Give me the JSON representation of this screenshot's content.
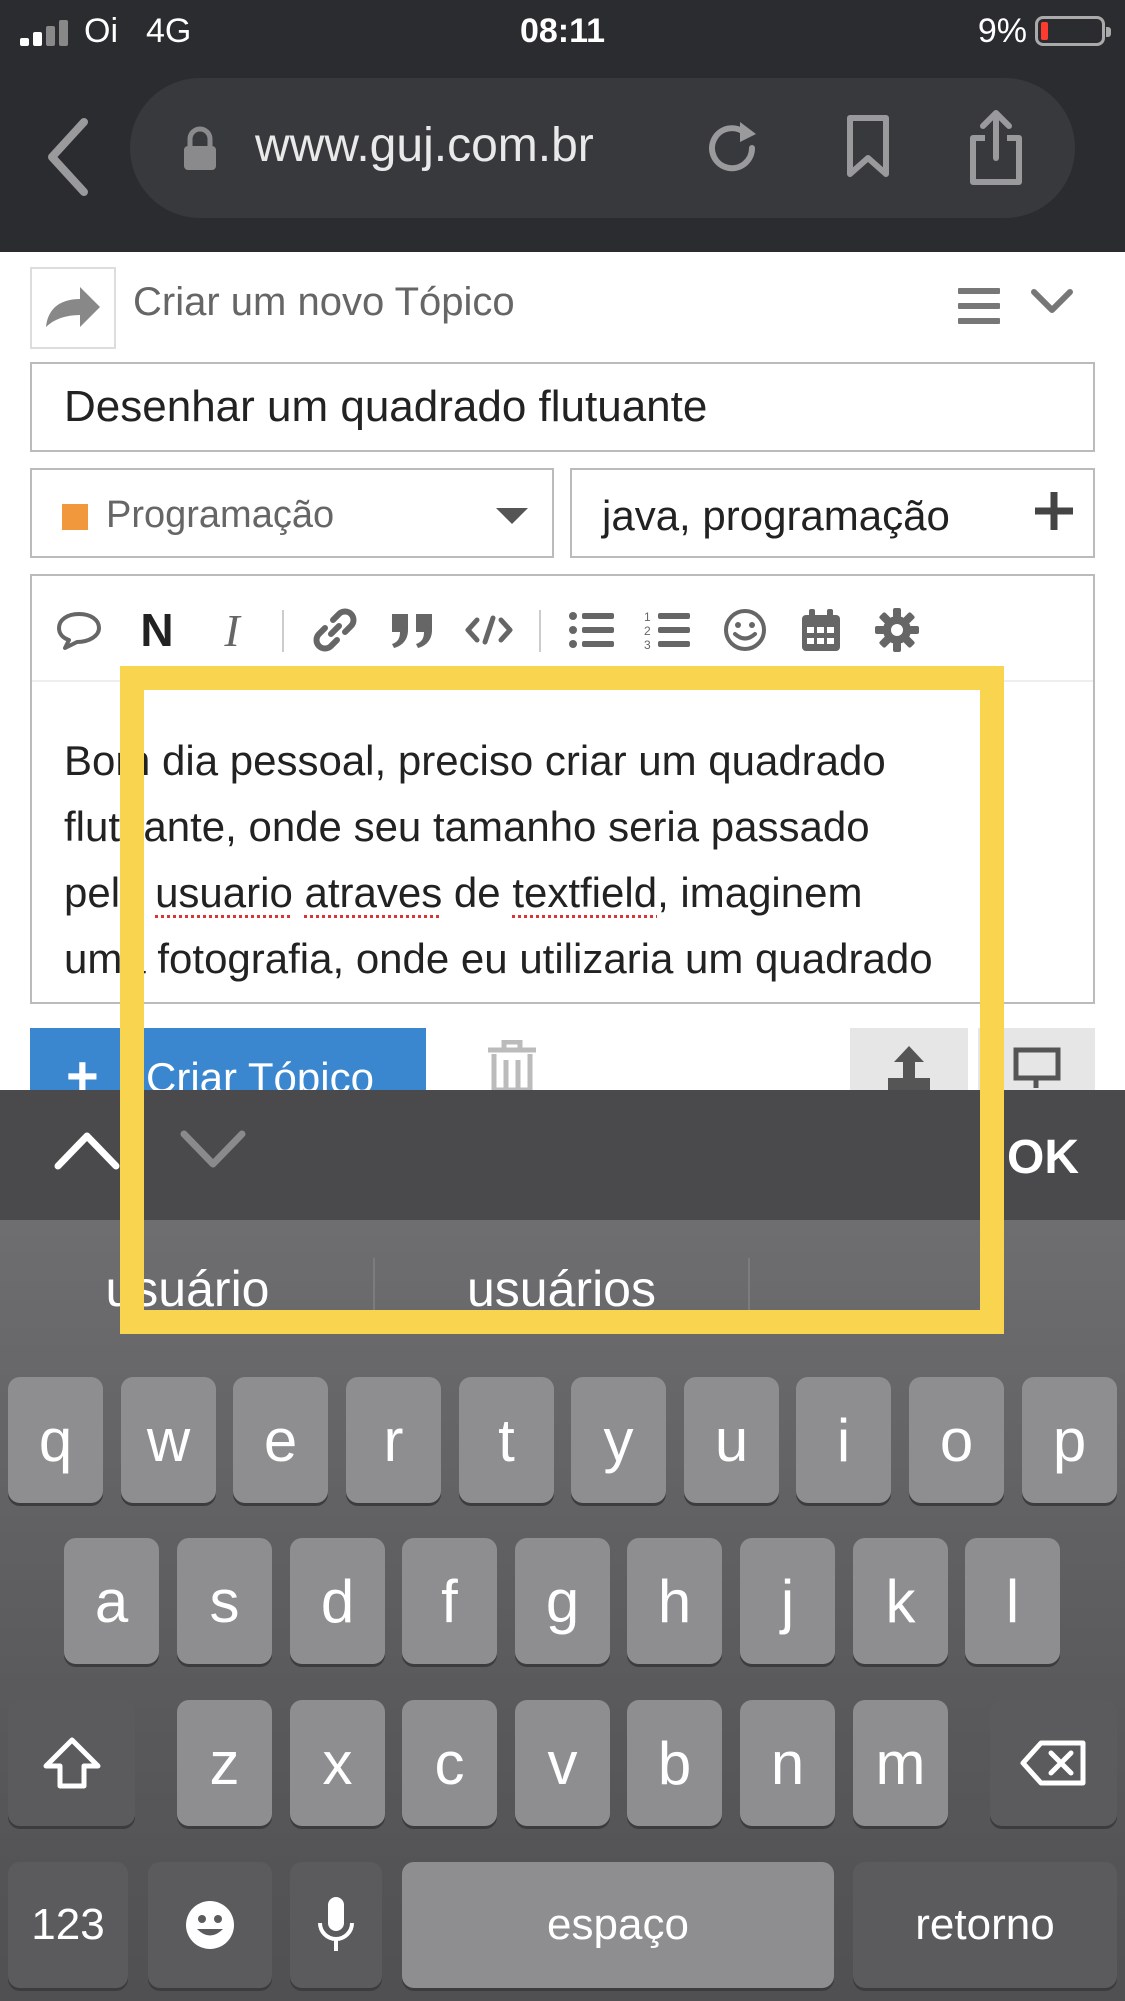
{
  "status_bar": {
    "carrier": "Oi",
    "network": "4G",
    "time": "08:11",
    "battery_percent": "9%",
    "battery_color": "#ff3b30"
  },
  "browser": {
    "url": "www.guj.com.br",
    "icons": [
      "back-icon",
      "lock-icon",
      "reload-icon",
      "bookmark-icon",
      "share-icon"
    ]
  },
  "composer": {
    "header_title": "Criar um novo Tópico",
    "title_value": "Desenhar um quadrado flutuante",
    "category": {
      "label": "Programação",
      "color": "#f0983b"
    },
    "tags_value": "java, programação",
    "toolbar": {
      "bold_glyph": "N",
      "italic_glyph": "I",
      "icons": [
        "speech-bubble-icon",
        "bold-icon",
        "italic-icon",
        "link-icon",
        "quote-icon",
        "code-icon",
        "bullet-list-icon",
        "numbered-list-icon",
        "emoji-icon",
        "calendar-icon",
        "gear-icon"
      ]
    },
    "body_lines": {
      "line1": "Bom dia pessoal, preciso criar um quadrado",
      "line2": "flutuante, onde seu tamanho seria passado",
      "line3_before": "pelo ",
      "line3_word1": "usuario",
      "line3_space1": " ",
      "line3_word2": "atraves",
      "line3_mid": " de ",
      "line3_word3": "textfield",
      "line3_after": ", imaginem",
      "line4": "uma fotografia, onde eu utilizaria um quadrado"
    },
    "create_button_label": "Criar Tópico",
    "accent_color": "#3a87cf"
  },
  "keyboard_accessory": {
    "done_label": "OK"
  },
  "keyboard": {
    "suggestions": [
      "usuário",
      "usuários"
    ],
    "row1": [
      "q",
      "w",
      "e",
      "r",
      "t",
      "y",
      "u",
      "i",
      "o",
      "p"
    ],
    "row2": [
      "a",
      "s",
      "d",
      "f",
      "g",
      "h",
      "j",
      "k",
      "l"
    ],
    "row3": [
      "z",
      "x",
      "c",
      "v",
      "b",
      "n",
      "m"
    ],
    "numbers_label": "123",
    "space_label": "espaço",
    "return_label": "retorno"
  },
  "highlight_color": "#f9d44f"
}
